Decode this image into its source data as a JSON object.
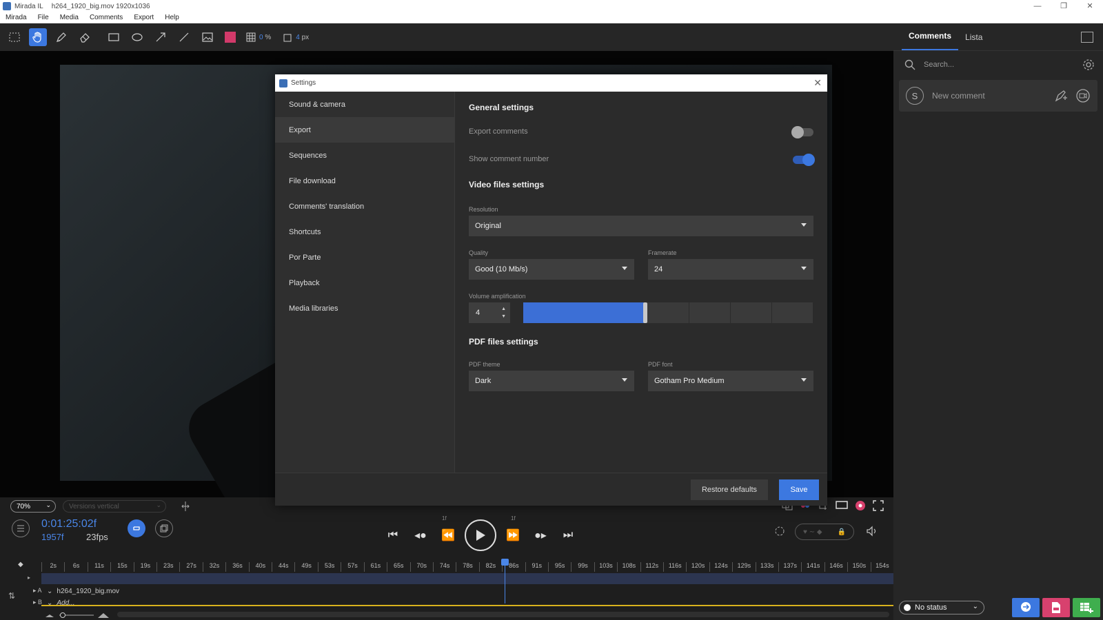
{
  "window": {
    "app_name": "Mirada IL",
    "file_title": "h264_1920_big.mov 1920x1036",
    "controls": [
      "—",
      "❐",
      "✕"
    ]
  },
  "menu": [
    "Mirada",
    "File",
    "Media",
    "Comments",
    "Export",
    "Help"
  ],
  "toolbar": {
    "icons": [
      "select-rect-icon",
      "hand-icon",
      "pen-icon",
      "eraser-icon",
      "rectangle-icon",
      "ellipse-icon",
      "arrow-icon",
      "line-icon",
      "image-icon"
    ],
    "active_tool": "hand-icon",
    "color": "#d23a6a",
    "opacity_value": "0",
    "opacity_unit": "%",
    "stroke_value": "4",
    "stroke_unit": "px"
  },
  "right_panel": {
    "tabs": [
      "Comments",
      "Lista"
    ],
    "active_tab": "Comments",
    "search_placeholder": "Search...",
    "avatar_letter": "S",
    "new_comment_placeholder": "New comment",
    "status_label": "No status"
  },
  "player": {
    "zoom": "70%",
    "versions_placeholder": "Versions vertical",
    "timecode": "0:01:25:02f",
    "frames": "1957f",
    "fps": "23fps",
    "step_label": "1f"
  },
  "timeline": {
    "ticks": [
      "2s",
      "6s",
      "11s",
      "15s",
      "19s",
      "23s",
      "27s",
      "32s",
      "36s",
      "40s",
      "44s",
      "49s",
      "53s",
      "57s",
      "61s",
      "65s",
      "70s",
      "74s",
      "78s",
      "82s",
      "86s",
      "91s",
      "95s",
      "99s",
      "103s",
      "108s",
      "112s",
      "116s",
      "120s",
      "124s",
      "129s",
      "133s",
      "137s",
      "141s",
      "146s",
      "150s",
      "154s"
    ],
    "track_a_label": "A",
    "track_b_label": "B",
    "track_a_name": "h264_1920_big.mov",
    "track_b_name": "Add..."
  },
  "settings": {
    "title": "Settings",
    "nav": [
      "Sound & camera",
      "Export",
      "Sequences",
      "File download",
      "Comments' translation",
      "Shortcuts",
      "Por Parte",
      "Playback",
      "Media libraries"
    ],
    "active_nav": "Export",
    "general_title": "General settings",
    "export_comments_label": "Export comments",
    "export_comments_on": false,
    "show_comment_number_label": "Show comment number",
    "show_comment_number_on": true,
    "video_title": "Video files settings",
    "resolution_label": "Resolution",
    "resolution_value": "Original",
    "quality_label": "Quality",
    "quality_value": "Good (10 Mb/s)",
    "framerate_label": "Framerate",
    "framerate_value": "24",
    "volume_label": "Volume amplification",
    "volume_value": "4",
    "volume_fraction": 0.42,
    "pdf_title": "PDF files settings",
    "pdf_theme_label": "PDF theme",
    "pdf_theme_value": "Dark",
    "pdf_font_label": "PDF font",
    "pdf_font_value": "Gotham Pro Medium",
    "restore_label": "Restore defaults",
    "save_label": "Save"
  },
  "colors": {
    "accent": "#3c78e0",
    "timeline_marker": "#d8b21d"
  }
}
